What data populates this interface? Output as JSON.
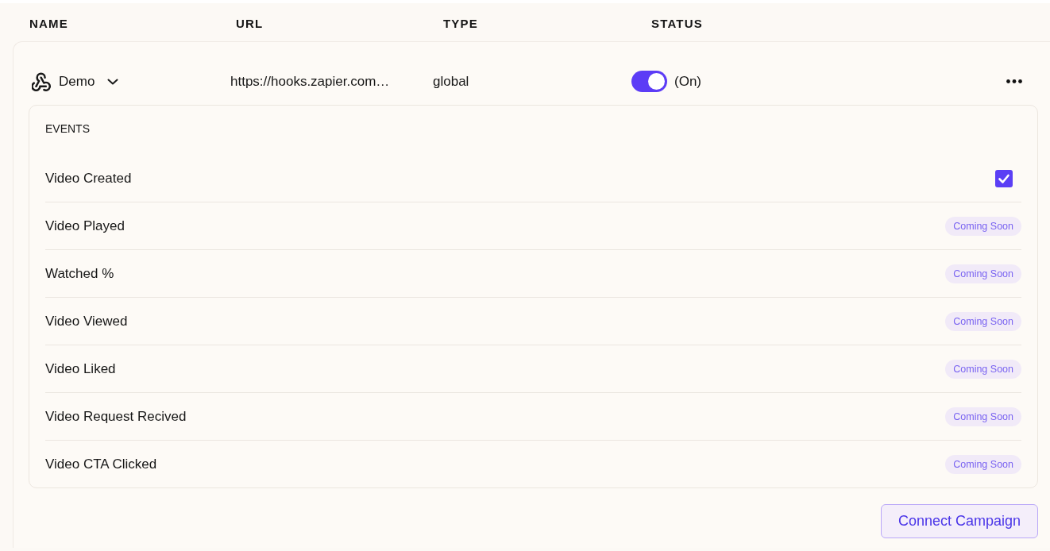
{
  "table": {
    "columns": [
      "NAME",
      "URL",
      "TYPE",
      "STATUS"
    ],
    "rows": [
      {
        "name": "Demo",
        "expanded": true,
        "url": "https://hooks.zapier.com…",
        "type": "global",
        "status": {
          "on": true,
          "label": "(On)"
        },
        "events": {
          "title": "EVENTS",
          "items": [
            {
              "kind": "checkbox",
              "label": "Video Created",
              "checked": true
            },
            {
              "kind": "badge",
              "label": "Video Played",
              "badge": "Coming Soon"
            },
            {
              "kind": "badge",
              "label": "Watched %",
              "badge": "Coming Soon"
            },
            {
              "kind": "badge",
              "label": "Video Viewed",
              "badge": "Coming Soon"
            },
            {
              "kind": "badge",
              "label": "Video Liked",
              "badge": "Coming Soon"
            },
            {
              "kind": "badge",
              "label": "Video Request Recived",
              "badge": "Coming Soon"
            },
            {
              "kind": "badge",
              "label": "Video CTA Clicked",
              "badge": "Coming Soon"
            }
          ]
        }
      }
    ]
  },
  "connect_button": "Connect Campaign"
}
